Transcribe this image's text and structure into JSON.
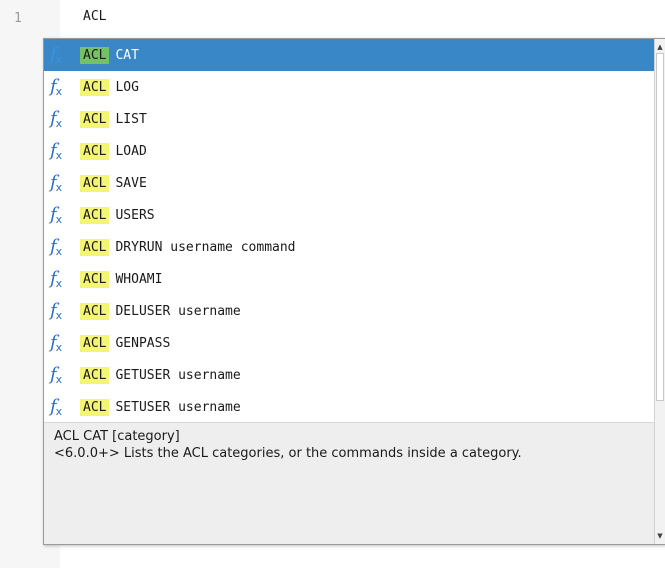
{
  "editor": {
    "line_number": "1",
    "code": "ACL"
  },
  "completion": {
    "match_text": "ACL",
    "items": [
      {
        "rest": "CAT",
        "icon": "function-icon",
        "selected": true
      },
      {
        "rest": "LOG",
        "icon": "function-icon"
      },
      {
        "rest": "LIST",
        "icon": "function-icon"
      },
      {
        "rest": "LOAD",
        "icon": "function-icon"
      },
      {
        "rest": "SAVE",
        "icon": "function-icon"
      },
      {
        "rest": "USERS",
        "icon": "function-icon"
      },
      {
        "rest": "DRYRUN username command",
        "icon": "function-icon"
      },
      {
        "rest": "WHOAMI",
        "icon": "function-icon"
      },
      {
        "rest": "DELUSER username",
        "icon": "function-icon"
      },
      {
        "rest": "GENPASS",
        "icon": "function-icon"
      },
      {
        "rest": "GETUSER username",
        "icon": "function-icon"
      },
      {
        "rest": "SETUSER username",
        "icon": "function-icon"
      }
    ],
    "description": {
      "signature": "ACL CAT [category]",
      "text": "<6.0.0+> Lists the ACL categories, or the commands inside a category."
    }
  },
  "colors": {
    "selection": "#3a87c7",
    "match_highlight": "#f4f573",
    "match_highlight_selected": "#76c066",
    "function_icon": "#2d6fc3"
  }
}
